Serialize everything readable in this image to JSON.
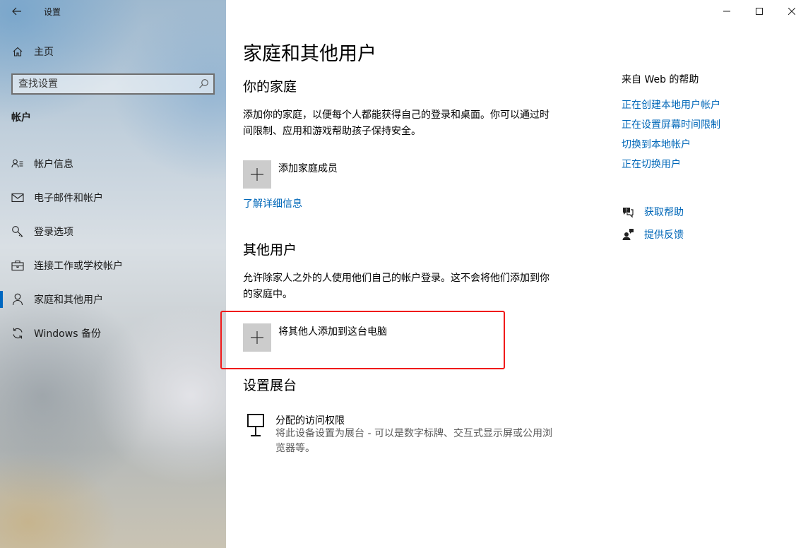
{
  "window": {
    "app_title": "设置",
    "minimize_icon": "minimize-icon",
    "maximize_icon": "maximize-icon",
    "close_icon": "close-icon"
  },
  "sidebar": {
    "home_label": "主页",
    "search_placeholder": "查找设置",
    "section_label": "帐户",
    "items": [
      {
        "label": "帐户信息",
        "icon": "account-info-icon",
        "selected": false
      },
      {
        "label": "电子邮件和帐户",
        "icon": "mail-icon",
        "selected": false
      },
      {
        "label": "登录选项",
        "icon": "key-icon",
        "selected": false
      },
      {
        "label": "连接工作或学校帐户",
        "icon": "briefcase-icon",
        "selected": false
      },
      {
        "label": "家庭和其他用户",
        "icon": "person-icon",
        "selected": true
      },
      {
        "label": "Windows 备份",
        "icon": "sync-icon",
        "selected": false
      }
    ]
  },
  "main": {
    "page_title": "家庭和其他用户",
    "family": {
      "heading": "你的家庭",
      "description": "添加你的家庭，以便每个人都能获得自己的登录和桌面。你可以通过时间限制、应用和游戏帮助孩子保持安全。",
      "add_label": "添加家庭成员",
      "learn_more": "了解详细信息"
    },
    "other_users": {
      "heading": "其他用户",
      "description": "允许除家人之外的人使用他们自己的帐户登录。这不会将他们添加到你的家庭中。",
      "add_label": "将其他人添加到这台电脑"
    },
    "kiosk": {
      "heading": "设置展台",
      "title": "分配的访问权限",
      "description": "将此设备设置为展台 - 可以是数字标牌、交互式显示屏或公用浏览器等。"
    }
  },
  "help": {
    "title": "来自 Web 的帮助",
    "links": [
      "正在创建本地用户帐户",
      "正在设置屏幕时间限制",
      "切换到本地帐户",
      "正在切换用户"
    ],
    "get_help": "获取帮助",
    "feedback": "提供反馈"
  },
  "colors": {
    "accent": "#0067b8",
    "highlight_border": "#f01a1a",
    "tile": "#cccccc"
  }
}
